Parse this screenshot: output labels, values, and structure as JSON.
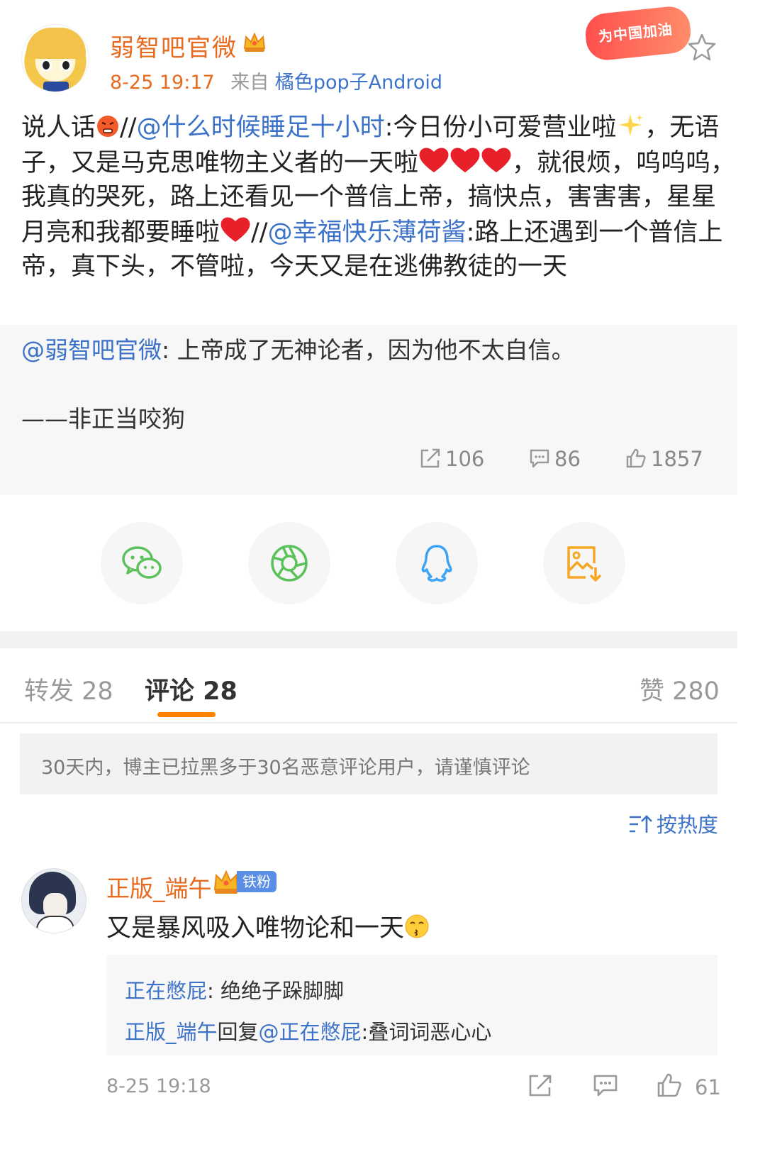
{
  "post": {
    "username": "弱智吧官微",
    "time": "8-25 19:17",
    "source_prefix": "来自",
    "source": "橘色pop子Android",
    "cheer_badge": "为中国加油",
    "body": {
      "p1": "说人话",
      "p2": "//",
      "at1": "@什么时候睡足十小时",
      "p3": ":今日份小可爱营业啦",
      "p4": "，无语子，又是马克思唯物主义者的一天啦",
      "p5": "，就很烦，呜呜呜，我真的哭死，路上还看见一个普信上帝，搞快点，害害害，星星月亮和我都要睡啦",
      "p6": "//",
      "at2": "@幸福快乐薄荷酱",
      "p7": ":路上还遇到一个普信上帝，真下头，不管啦，今天又是在逃佛教徒的一天"
    }
  },
  "repost": {
    "at": "@弱智吧官微",
    "text": ": 上帝成了无神论者，因为他不太自信。",
    "signature": "——非正当咬狗",
    "shares": "106",
    "comments": "86",
    "likes": "1857"
  },
  "share_targets": [
    "wechat-icon",
    "moments-icon",
    "qq-icon",
    "save-image-icon"
  ],
  "tabs": {
    "repost": "转发 28",
    "comments": "评论 28",
    "likes": "赞 280"
  },
  "notice": "30天内，博主已拉黑多于30名恶意评论用户，请谨慎评论",
  "sort_label": "按热度",
  "comment": {
    "username": "正版_端午",
    "fan_badge": "铁粉",
    "text": "又是暴风吸入唯物论和一天",
    "replies": [
      {
        "user": "正在憋屁",
        "sep": ": ",
        "text": "绝绝子跺脚脚"
      },
      {
        "user": "正版_端午",
        "mid": "回复",
        "at": "@正在憋屁",
        "text": ":叠词词恶心心"
      }
    ],
    "time": "8-25 19:18",
    "likes": "61"
  },
  "colors": {
    "accent_orange": "#e86a1f",
    "link_blue": "#3d72c9",
    "tab_underline": "#ff8200"
  }
}
